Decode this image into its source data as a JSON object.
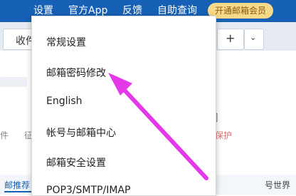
{
  "topnav": {
    "settings": "设置",
    "app": "官方App",
    "feedback": "反馈",
    "self_help": "自助查询",
    "vip": "开通邮箱会员"
  },
  "tabs": {
    "favorites": "收件"
  },
  "background": {
    "left_char1": "件",
    "left_char2": "征",
    "protect": "保护",
    "push": "邮推荐",
    "world": "号世界"
  },
  "menu": {
    "items": [
      "常规设置",
      "邮箱密码修改",
      "English",
      "帐号与邮箱中心",
      "邮箱安全设置",
      "POP3/SMTP/IMAP"
    ]
  },
  "colors": {
    "topbar": "#1660b5",
    "arrow": "#e339e8",
    "vip_bg": "#f6d98a"
  }
}
